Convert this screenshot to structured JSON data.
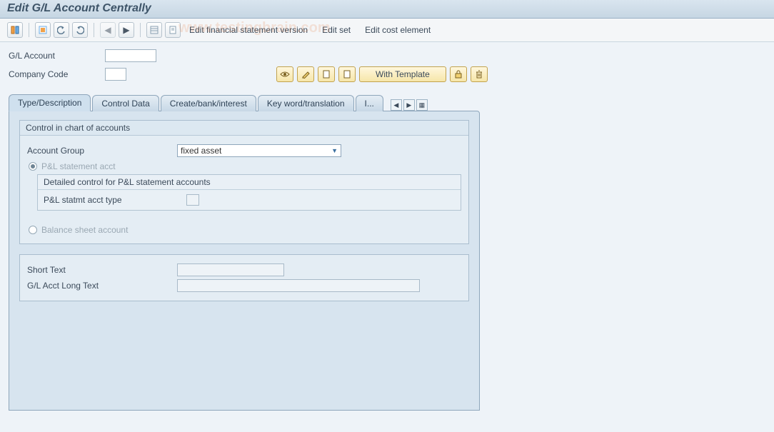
{
  "title": "Edit G/L Account Centrally",
  "toolbar": {
    "text_links": [
      "Edit financial statement version",
      "Edit set",
      "Edit cost element"
    ]
  },
  "header": {
    "gl_account_label": "G/L Account",
    "gl_account_value": "",
    "company_code_label": "Company Code",
    "company_code_value": ""
  },
  "actions": {
    "with_template_label": "With Template"
  },
  "tabs": {
    "items": [
      "Type/Description",
      "Control Data",
      "Create/bank/interest",
      "Key word/translation",
      "I..."
    ],
    "active_index": 0
  },
  "panel": {
    "group1_title": "Control in chart of accounts",
    "account_group_label": "Account Group",
    "account_group_value": "fixed asset",
    "radio_pl_label": "P&L statement acct",
    "subgroup_title": "Detailed control for P&L statement accounts",
    "pl_type_label": "P&L statmt acct type",
    "pl_type_value": "",
    "radio_bs_label": "Balance sheet account",
    "short_text_label": "Short Text",
    "short_text_value": "",
    "long_text_label": "G/L Acct Long Text",
    "long_text_value": ""
  }
}
